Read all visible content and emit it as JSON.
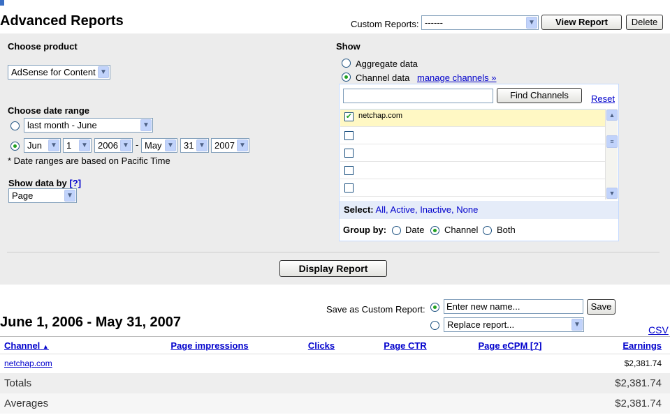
{
  "header": {
    "title": "Advanced Reports",
    "custom_reports_label": "Custom Reports:",
    "custom_reports_value": "------",
    "view_report_label": "View Report",
    "delete_label": "Delete"
  },
  "choose_product": {
    "heading": "Choose product",
    "value": "AdSense for Content"
  },
  "date_range": {
    "heading": "Choose date range",
    "preset_value": "last month - June",
    "start_month": "Jun",
    "start_day": "1",
    "start_year": "2006",
    "separator": "-",
    "end_month": "May",
    "end_day": "31",
    "end_year": "2007",
    "note": "* Date ranges are based on Pacific Time"
  },
  "show_data_by": {
    "heading": "Show data by",
    "help": "[?]",
    "value": "Page"
  },
  "show": {
    "heading": "Show",
    "aggregate_label": "Aggregate data",
    "channel_label": "Channel data",
    "manage_channels": "manage channels »",
    "find_channels_label": "Find Channels",
    "reset_label": "Reset",
    "channels": [
      {
        "name": "netchap.com",
        "checked": true
      },
      {
        "name": "",
        "checked": false
      },
      {
        "name": "",
        "checked": false
      },
      {
        "name": "",
        "checked": false
      },
      {
        "name": "",
        "checked": false
      }
    ],
    "select_label": "Select:",
    "select_all": "All",
    "select_active": "Active",
    "select_inactive": "Inactive",
    "select_none": "None",
    "group_by_label": "Group by:",
    "group_date": "Date",
    "group_channel": "Channel",
    "group_both": "Both"
  },
  "display_report_label": "Display Report",
  "save": {
    "label": "Save as Custom Report:",
    "name_placeholder": "Enter new name...",
    "save_label": "Save",
    "replace_value": "Replace report..."
  },
  "report": {
    "range_title": "June 1, 2006 - May 31, 2007",
    "csv": "CSV",
    "columns": [
      "Channel",
      "Page impressions",
      "Clicks",
      "Page CTR",
      "Page eCPM [?]",
      "Earnings"
    ],
    "row": {
      "channel": "netchap.com",
      "earnings": "$2,381.74"
    },
    "totals_label": "Totals",
    "totals_earnings": "$2,381.74",
    "averages_label": "Averages",
    "averages_earnings": "$2,381.74"
  },
  "colors": {
    "link": "#0000cc",
    "panel": "#ececec",
    "selected_row": "#fff8c4",
    "radio_on": "#21a121"
  }
}
